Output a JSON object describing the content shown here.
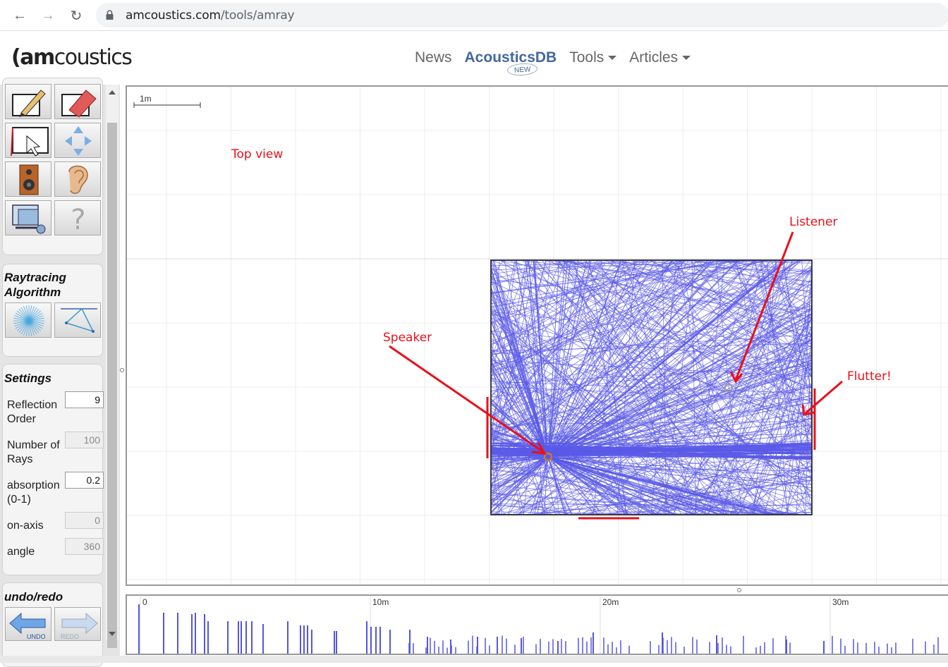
{
  "browser": {
    "url_host": "amcoustics.com",
    "url_path": "/tools/amray"
  },
  "site": {
    "logo_mark": "(am",
    "logo_text": "coustics",
    "nav": [
      {
        "label": "News"
      },
      {
        "label": "AcousticsDB",
        "badge": "NEW"
      },
      {
        "label": "Tools"
      },
      {
        "label": "Articles"
      }
    ]
  },
  "panel": {
    "tools": [
      {
        "name": "draw-wall-icon"
      },
      {
        "name": "eraser-icon"
      },
      {
        "name": "select-icon"
      },
      {
        "name": "move-icon"
      },
      {
        "name": "speaker-icon"
      },
      {
        "name": "ear-icon"
      },
      {
        "name": "settings-screen-icon"
      },
      {
        "name": "help-icon"
      }
    ],
    "raytracing_title": "Raytracing Algorithm",
    "settings_title": "Settings",
    "settings": [
      {
        "label": "Reflection Order",
        "value": "9",
        "disabled": false
      },
      {
        "label": "Number of Rays",
        "value": "100",
        "disabled": true
      },
      {
        "label": "absorption (0-1)",
        "value": "0.2",
        "disabled": false
      },
      {
        "label": "on-axis",
        "value": "0",
        "disabled": true
      },
      {
        "label": "angle",
        "value": "360",
        "disabled": true
      }
    ],
    "undo_title": "undo/redo",
    "undo_label": "UNDO",
    "redo_label": "REDO"
  },
  "canvas": {
    "scale_label": "1m",
    "top_view_label": "Top view",
    "annotations": {
      "listener": "Listener",
      "speaker": "Speaker",
      "flutter": "Flutter!"
    },
    "ray_color": "#5a5ae8",
    "annotation_color": "#e8101a"
  },
  "echogram": {
    "ticks": [
      "0",
      "10m",
      "20m",
      "30m"
    ],
    "bar_color": "#5555e0"
  }
}
